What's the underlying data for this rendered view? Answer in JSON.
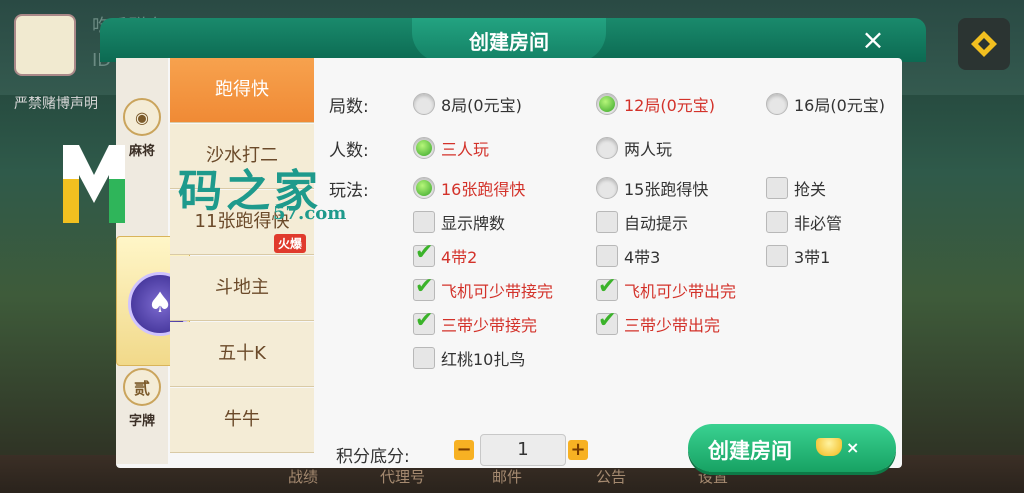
{
  "background": {
    "name_text": "吃瓜群众",
    "id_text": "ID",
    "warning_text": "严禁赌博声明",
    "bottom_nav": [
      "战绩",
      "代理号",
      "邮件",
      "公告",
      "设置"
    ]
  },
  "watermark": {
    "logo_letter": "M",
    "text": "码之家",
    "url": "57.com"
  },
  "dialog": {
    "title": "创建房间",
    "close_label": "×",
    "categories": [
      {
        "label": "麻将",
        "icon": "mahjong-icon"
      },
      {
        "label": "",
        "icon": "spade-icon"
      },
      {
        "label": "字牌",
        "icon": "zipai-icon",
        "glyph": "贰"
      }
    ],
    "games": [
      {
        "label": "跑得快",
        "active": true
      },
      {
        "label": "沙水打二",
        "active": false
      },
      {
        "label": "11张跑得快",
        "active": false,
        "badge": "火爆"
      },
      {
        "label": "斗地主",
        "active": false
      },
      {
        "label": "五十K",
        "active": false
      },
      {
        "label": "牛牛",
        "active": false
      }
    ],
    "rows": {
      "rounds": {
        "label": "局数:",
        "options": [
          {
            "label": "8局(0元宝)",
            "selected": false
          },
          {
            "label": "12局(0元宝)",
            "selected": true
          },
          {
            "label": "16局(0元宝)",
            "selected": false
          }
        ]
      },
      "players": {
        "label": "人数:",
        "options": [
          {
            "label": "三人玩",
            "selected": true
          },
          {
            "label": "两人玩",
            "selected": false
          }
        ]
      },
      "play": {
        "label": "玩法:",
        "options": [
          {
            "label": "16张跑得快",
            "selected": true
          },
          {
            "label": "15张跑得快",
            "selected": false
          },
          {
            "label": "抢关",
            "selected": false
          }
        ]
      },
      "checks": [
        {
          "label": "显示牌数",
          "checked": false
        },
        {
          "label": "自动提示",
          "checked": false
        },
        {
          "label": "非必管",
          "checked": false
        },
        {
          "label": "4带2",
          "checked": true
        },
        {
          "label": "4带3",
          "checked": false
        },
        {
          "label": "3带1",
          "checked": false
        },
        {
          "label": "飞机可少带接完",
          "checked": true
        },
        {
          "label": "飞机可少带出完",
          "checked": true
        },
        {
          "label": "三带少带接完",
          "checked": true
        },
        {
          "label": "三带少带出完",
          "checked": true
        },
        {
          "label": "红桃10扎鸟",
          "checked": false
        }
      ]
    },
    "score": {
      "label": "积分底分:",
      "value": "1",
      "minus": "−",
      "plus": "+"
    },
    "create_button": {
      "label": "创建房间",
      "cost_suffix": "×"
    }
  }
}
